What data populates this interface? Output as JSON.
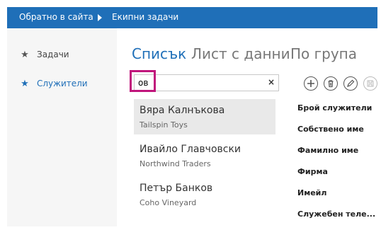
{
  "breadcrumb": {
    "back": "Обратно в сайта",
    "current": "Екипни задачи"
  },
  "sidebar": {
    "items": [
      {
        "label": "Задачи",
        "icon": "star-icon"
      },
      {
        "label": "Служители",
        "icon": "star-icon"
      }
    ]
  },
  "tabs": [
    {
      "label": "Списък"
    },
    {
      "label": "Лист с данни"
    },
    {
      "label": "По група"
    }
  ],
  "search": {
    "value": "ов",
    "clear_glyph": "×"
  },
  "list": [
    {
      "name": "Вяра Калнъкова",
      "company": "Tailspin Toys"
    },
    {
      "name": "Ивайло Главчовски",
      "company": "Northwind Traders"
    },
    {
      "name": "Петър Банков",
      "company": "Coho Vineyard"
    }
  ],
  "toolbar": [
    "add-icon",
    "delete-icon",
    "edit-icon",
    "save-icon"
  ],
  "fields": [
    "Брой служители",
    "Собствено име",
    "Фамилно име",
    "Фирма",
    "Имейл",
    "Служебен теле..."
  ],
  "colors": {
    "accent": "#1f6fb8",
    "highlight": "#c0157b"
  }
}
